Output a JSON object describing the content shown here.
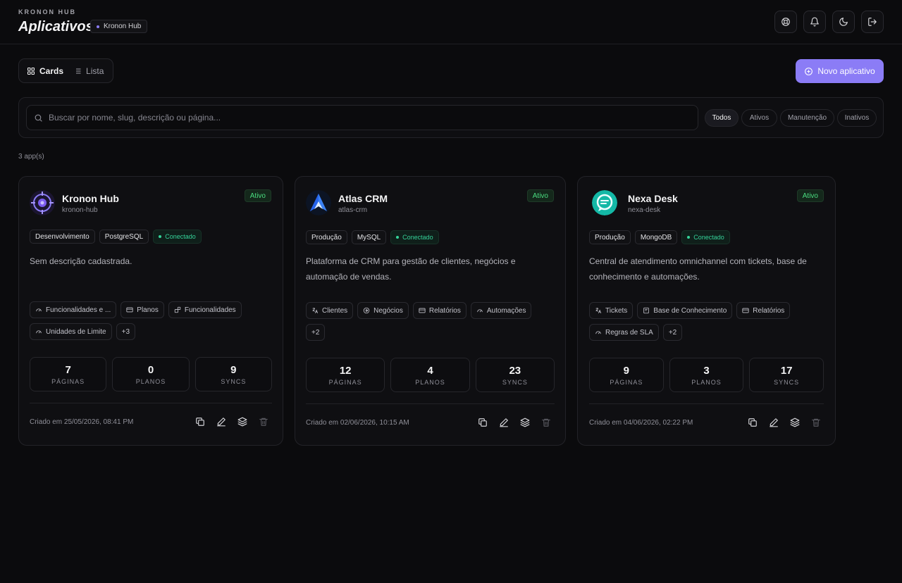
{
  "header": {
    "brand": "KRONON HUB",
    "title": "Aplicativos",
    "workspace": "Kronon Hub",
    "icons": [
      "support-icon",
      "bell-icon",
      "moon-icon",
      "logout-icon"
    ]
  },
  "view_toggle": {
    "cards": "Cards",
    "list": "Lista",
    "active": "cards"
  },
  "new_app_label": "Novo aplicativo",
  "search": {
    "placeholder": "Buscar por nome, slug, descrição ou página...",
    "value": ""
  },
  "filters": [
    {
      "label": "Todos",
      "active": true
    },
    {
      "label": "Ativos",
      "active": false
    },
    {
      "label": "Manutenção",
      "active": false
    },
    {
      "label": "Inativos",
      "active": false
    }
  ],
  "count_label": "3 app(s)",
  "colors": {
    "accent": "#8b7cf6",
    "status_active": "#4ade80",
    "connected": "#34d399"
  },
  "apps": [
    {
      "name": "Kronon Hub",
      "slug": "kronon-hub",
      "status": "Ativo",
      "env": "Desenvolvimento",
      "db": "PostgreSQL",
      "conn": "Conectado",
      "description": "Sem descrição cadastrada.",
      "modules": [
        "Funcionalidades e ...",
        "Planos",
        "Funcionalidades",
        "Unidades de Limite"
      ],
      "more": "+3",
      "stats": [
        {
          "value": "7",
          "label": "PÁGINAS"
        },
        {
          "value": "0",
          "label": "PLANOS"
        },
        {
          "value": "9",
          "label": "SYNCS"
        }
      ],
      "created": "Criado em 25/05/2026, 08:41 PM"
    },
    {
      "name": "Atlas CRM",
      "slug": "atlas-crm",
      "status": "Ativo",
      "env": "Produção",
      "db": "MySQL",
      "conn": "Conectado",
      "description": "Plataforma de CRM para gestão de clientes, negócios e automação de vendas.",
      "modules": [
        "Clientes",
        "Negócios",
        "Relatórios",
        "Automações"
      ],
      "more": "+2",
      "stats": [
        {
          "value": "12",
          "label": "PÁGINAS"
        },
        {
          "value": "4",
          "label": "PLANOS"
        },
        {
          "value": "23",
          "label": "SYNCS"
        }
      ],
      "created": "Criado em 02/06/2026, 10:15 AM"
    },
    {
      "name": "Nexa Desk",
      "slug": "nexa-desk",
      "status": "Ativo",
      "env": "Produção",
      "db": "MongoDB",
      "conn": "Conectado",
      "description": "Central de atendimento omnichannel com tickets, base de conhecimento e automações.",
      "modules": [
        "Tickets",
        "Base de Conhecimento",
        "Relatórios",
        "Regras de SLA"
      ],
      "more": "+2",
      "stats": [
        {
          "value": "9",
          "label": "PÁGINAS"
        },
        {
          "value": "3",
          "label": "PLANOS"
        },
        {
          "value": "17",
          "label": "SYNCS"
        }
      ],
      "created": "Criado em 04/06/2026, 02:22 PM"
    }
  ]
}
